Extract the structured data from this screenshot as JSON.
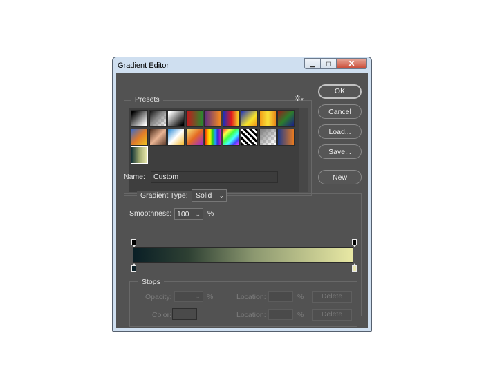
{
  "window": {
    "title": "Gradient Editor",
    "controls": {
      "minimize": "▁",
      "maximize": "◻",
      "close": "✕"
    }
  },
  "presets": {
    "label": "Presets",
    "gear_glyph": "✲",
    "gear_caret": "▾",
    "swatches": [
      "linear-gradient(135deg,#000 10%,#fff 90%)",
      "linear-gradient(135deg,#111 0%,#888 45%,transparent 100%)",
      "linear-gradient(135deg,#fff 10%,#000 90%)",
      "linear-gradient(90deg,#c4161c,#2a8a2e)",
      "linear-gradient(90deg,#5a2d82,#f58a1f)",
      "linear-gradient(90deg,#1a2fbf,#e21b1b,#f7e42a)",
      "linear-gradient(135deg,#1a2fbf,#f7e42a 60%,#f08d1a)",
      "linear-gradient(90deg,#f29c18,#f8e23a,#e8891a)",
      "linear-gradient(135deg,#9a1a1a,#2c7d2c,#1a1a8c)",
      "linear-gradient(135deg,#3c6cc7,#e07b2a,#f0c51e)",
      "linear-gradient(135deg,#4a2a1a,#e8b393,#5c3a2a)",
      "linear-gradient(135deg,#2a8ad6,#ffffff,#f5b82a)",
      "linear-gradient(135deg,#f6e47a,#e56b22,#9b2ad6)",
      "linear-gradient(90deg,#e11,#f90,#ff0,#2c2,#29f,#32c,#c2c)",
      "linear-gradient(135deg,#f44,#ff4,#4f4,#4ff,#44f,#f4f)",
      "repeating-linear-gradient(45deg,#000 0 3px,#fff 3px 6px)",
      "linear-gradient(135deg,#888 10%,transparent 90%)",
      "linear-gradient(90deg,#1b3a8f,#e87a20)",
      "linear-gradient(90deg,#0f2f35,#9fa86e,#ecebb0)"
    ]
  },
  "buttons": {
    "ok": "OK",
    "cancel": "Cancel",
    "load": "Load...",
    "save": "Save...",
    "new": "New"
  },
  "name": {
    "label": "Name:",
    "value": "Custom"
  },
  "gradient": {
    "type_label": "Gradient Type:",
    "type_value": "Solid",
    "smoothness_label": "Smoothness:",
    "smoothness_value": "100",
    "percent": "%",
    "colors": [
      "#0a1f26",
      "#2e4033",
      "#8c9870",
      "#e8e8a4"
    ],
    "end_color": "#e9e6b0"
  },
  "stops": {
    "label": "Stops",
    "opacity_label": "Opacity:",
    "percent": "%",
    "location_label": "Location:",
    "color_label": "Color:",
    "delete_label": "Delete"
  },
  "chevron": "⌄"
}
